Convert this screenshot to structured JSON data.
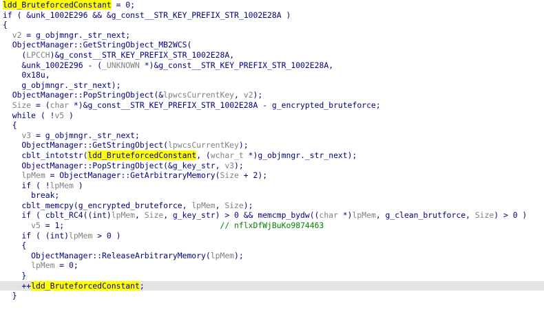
{
  "editor": {
    "lines": [
      [
        {
          "t": "ldd_BruteforcedConstant",
          "c": "hl"
        },
        {
          "t": " = 0;",
          "c": "default"
        }
      ],
      [
        {
          "t": "if ( &unk_1002E296 && &g_const__STR_KEY_PREFIX_STR_1002E28A )",
          "c": "default"
        }
      ],
      [
        {
          "t": "{",
          "c": "default"
        }
      ],
      [
        {
          "t": "  ",
          "c": "default"
        },
        {
          "t": "v2",
          "c": "var"
        },
        {
          "t": " = g_objmngr._str_next;",
          "c": "default"
        }
      ],
      [
        {
          "t": "  ObjectManager::GetStringObject_MB2WCS(",
          "c": "default"
        }
      ],
      [
        {
          "t": "    (",
          "c": "default"
        },
        {
          "t": "LPCCH",
          "c": "var"
        },
        {
          "t": ")&g_const__STR_KEY_PREFIX_STR_1002E28A,",
          "c": "default"
        }
      ],
      [
        {
          "t": "    &unk_1002E296 - (",
          "c": "default"
        },
        {
          "t": "_UNKNOWN",
          "c": "var"
        },
        {
          "t": " *)&g_const__STR_KEY_PREFIX_STR_1002E28A,",
          "c": "default"
        }
      ],
      [
        {
          "t": "    0x18u,",
          "c": "default"
        }
      ],
      [
        {
          "t": "    g_objmngr._str_next);",
          "c": "default"
        }
      ],
      [
        {
          "t": "  ObjectManager::PopStringObject(&",
          "c": "default"
        },
        {
          "t": "lpwcsCurrentKey",
          "c": "var"
        },
        {
          "t": ", ",
          "c": "default"
        },
        {
          "t": "v2",
          "c": "var"
        },
        {
          "t": ");",
          "c": "default"
        }
      ],
      [
        {
          "t": "  ",
          "c": "default"
        },
        {
          "t": "Size",
          "c": "var"
        },
        {
          "t": " = (",
          "c": "default"
        },
        {
          "t": "char",
          "c": "var"
        },
        {
          "t": " *)&g_const__STR_KEY_PREFIX_STR_1002E28A - g_encrypted_bruteforce;",
          "c": "default"
        }
      ],
      [
        {
          "t": "  while ( !",
          "c": "default"
        },
        {
          "t": "v5",
          "c": "var"
        },
        {
          "t": " )",
          "c": "default"
        }
      ],
      [
        {
          "t": "  {",
          "c": "default"
        }
      ],
      [
        {
          "t": "    ",
          "c": "default"
        },
        {
          "t": "v3",
          "c": "var"
        },
        {
          "t": " = g_objmngr._str_next;",
          "c": "default"
        }
      ],
      [
        {
          "t": "    ObjectManager::GetStringObject(",
          "c": "default"
        },
        {
          "t": "lpwcsCurrentKey",
          "c": "var"
        },
        {
          "t": ");",
          "c": "default"
        }
      ],
      [
        {
          "t": "    cblt_intotstr(",
          "c": "default"
        },
        {
          "t": "ldd_BruteforcedConstant",
          "c": "hl"
        },
        {
          "t": ", (",
          "c": "default"
        },
        {
          "t": "wchar_t",
          "c": "var"
        },
        {
          "t": " *)g_objmngr._str_next);",
          "c": "default"
        }
      ],
      [
        {
          "t": "    ObjectManager::PopStringObject(&g_key_str, ",
          "c": "default"
        },
        {
          "t": "v3",
          "c": "var"
        },
        {
          "t": ");",
          "c": "default"
        }
      ],
      [
        {
          "t": "    ",
          "c": "default"
        },
        {
          "t": "lpMem",
          "c": "var"
        },
        {
          "t": " = ObjectManager::GetArbitraryMemory(",
          "c": "default"
        },
        {
          "t": "Size",
          "c": "var"
        },
        {
          "t": " + 2);",
          "c": "default"
        }
      ],
      [
        {
          "t": "    if ( !",
          "c": "default"
        },
        {
          "t": "lpMem",
          "c": "var"
        },
        {
          "t": " )",
          "c": "default"
        }
      ],
      [
        {
          "t": "      break;",
          "c": "default"
        }
      ],
      [
        {
          "t": "    cblt_memcpy(g_encrypted_bruteforce, ",
          "c": "default"
        },
        {
          "t": "lpMem",
          "c": "var"
        },
        {
          "t": ", ",
          "c": "default"
        },
        {
          "t": "Size",
          "c": "var"
        },
        {
          "t": ");",
          "c": "default"
        }
      ],
      [
        {
          "t": "    if ( cblt_RC4((int)",
          "c": "default"
        },
        {
          "t": "lpMem",
          "c": "var"
        },
        {
          "t": ", ",
          "c": "default"
        },
        {
          "t": "Size",
          "c": "var"
        },
        {
          "t": ", g_key_str) > 0 && memcmp_bydw((",
          "c": "default"
        },
        {
          "t": "char",
          "c": "var"
        },
        {
          "t": " *)",
          "c": "default"
        },
        {
          "t": "lpMem",
          "c": "var"
        },
        {
          "t": ", g_clean_brutforce, ",
          "c": "default"
        },
        {
          "t": "Size",
          "c": "var"
        },
        {
          "t": ") > 0 )",
          "c": "default"
        }
      ],
      [
        {
          "t": "      ",
          "c": "default"
        },
        {
          "t": "v5",
          "c": "var"
        },
        {
          "t": " = 1;",
          "c": "default"
        },
        {
          "t": "                                 ",
          "c": "default"
        },
        {
          "t": "// nflxDfWjBuKo9874463",
          "c": "comment"
        }
      ],
      [
        {
          "t": "    if ( (int)",
          "c": "default"
        },
        {
          "t": "lpMem",
          "c": "var"
        },
        {
          "t": " > 0 )",
          "c": "default"
        }
      ],
      [
        {
          "t": "    {",
          "c": "default"
        }
      ],
      [
        {
          "t": "      ObjectManager::ReleaseArbitraryMemory(",
          "c": "default"
        },
        {
          "t": "lpMem",
          "c": "var"
        },
        {
          "t": ");",
          "c": "default"
        }
      ],
      [
        {
          "t": "      ",
          "c": "default"
        },
        {
          "t": "lpMem",
          "c": "var"
        },
        {
          "t": " = 0;",
          "c": "default"
        }
      ],
      [
        {
          "t": "    }",
          "c": "default"
        }
      ],
      [
        {
          "t": "    ++",
          "c": "default"
        },
        {
          "t": "ldd_BruteforcedConstant",
          "c": "hl"
        },
        {
          "t": ";",
          "c": "default"
        }
      ],
      [
        {
          "t": "  }",
          "c": "default"
        }
      ]
    ],
    "current_line": 28
  }
}
